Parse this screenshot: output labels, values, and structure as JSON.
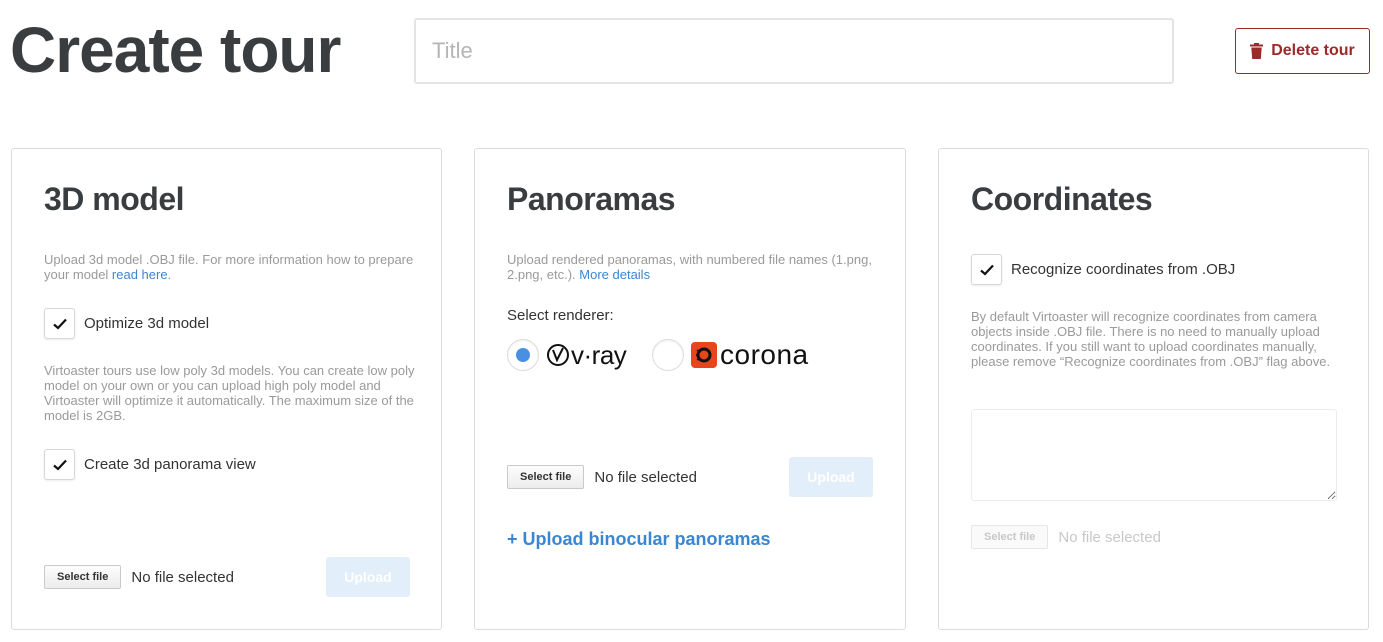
{
  "header": {
    "title": "Create tour",
    "title_input_placeholder": "Title",
    "delete_label": "Delete tour"
  },
  "model_card": {
    "heading": "3D model",
    "help_text": "Upload 3d model .OBJ file. For more information how to prepare your model ",
    "help_link": "read here",
    "help_after": ".",
    "optimize_label": "Optimize 3d model",
    "optimize_checked": true,
    "lowpoly_text": "Virtoaster tours use low poly 3d models. You can create low poly model on your own or you can upload high poly model and Virtoaster will optimize it automatically. The maximum size of the model is 2GB.",
    "panorama_view_label": "Create 3d panorama view",
    "panorama_view_checked": true,
    "select_file_label": "Select file",
    "no_file_label": "No file selected",
    "upload_label": "Upload"
  },
  "panoramas_card": {
    "heading": "Panoramas",
    "help_text": "Upload rendered panoramas, with numbered file names (1.png, 2.png, etc.). ",
    "help_link": "More details",
    "renderer_label": "Select renderer:",
    "renderers": [
      {
        "name": "v·ray",
        "selected": true
      },
      {
        "name": "corona",
        "selected": false
      }
    ],
    "select_file_label": "Select file",
    "no_file_label": "No file selected",
    "upload_label": "Upload",
    "binocular_link": "+ Upload binocular panoramas"
  },
  "coordinates_card": {
    "heading": "Coordinates",
    "recognize_label": "Recognize coordinates from .OBJ",
    "recognize_checked": true,
    "help_text": "By default Virtoaster will recognize coordinates from camera objects inside .OBJ file. There is no need to manually upload coordinates. If you still want to upload coordinates manually, please remove “Recognize coordinates from .OBJ” flag above.",
    "select_file_label": "Select file",
    "no_file_label": "No file selected"
  },
  "colors": {
    "accent": "#3b86d2",
    "danger": "#9b2a2a",
    "upload_disabled": "#e2eefa",
    "corona_brand": "#e8451e"
  }
}
